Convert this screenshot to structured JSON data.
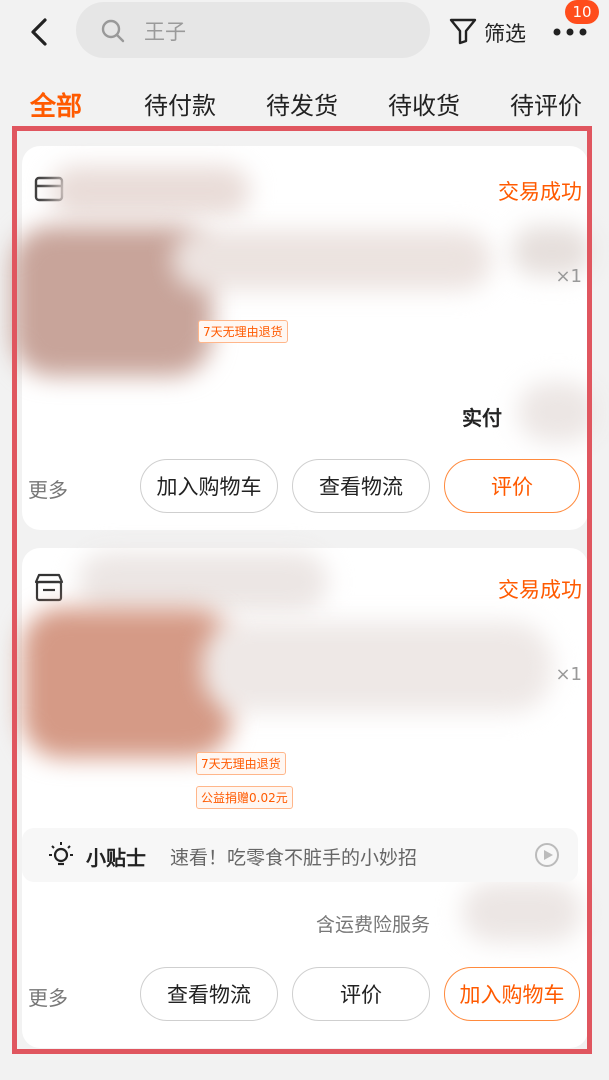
{
  "header": {
    "search_text": "王子",
    "filter_label": "筛选",
    "notification_count": "10"
  },
  "tabs": [
    "全部",
    "待付款",
    "待发货",
    "待收货",
    "待评价"
  ],
  "orders": [
    {
      "status": "交易成功",
      "qty": "×1",
      "tags": [
        "7天无理由退货"
      ],
      "paid_label": "实付",
      "more": "更多",
      "buttons": [
        "加入购物车",
        "查看物流",
        "评价"
      ]
    },
    {
      "status": "交易成功",
      "qty": "×1",
      "tags": [
        "7天无理由退货",
        "公益捐赠0.02元"
      ],
      "tip": {
        "title": "小贴士",
        "text": "速看！吃零食不脏手的小妙招"
      },
      "insurance": "含运费险服务",
      "more": "更多",
      "buttons": [
        "查看物流",
        "评价",
        "加入购物车"
      ]
    }
  ],
  "colors": {
    "accent": "#ff5a00",
    "highlight_border": "#e0565f"
  },
  "icons": [
    "back-icon",
    "search-icon",
    "filter-icon",
    "more-dots-icon",
    "shop-icon",
    "bulb-icon",
    "play-icon"
  ]
}
